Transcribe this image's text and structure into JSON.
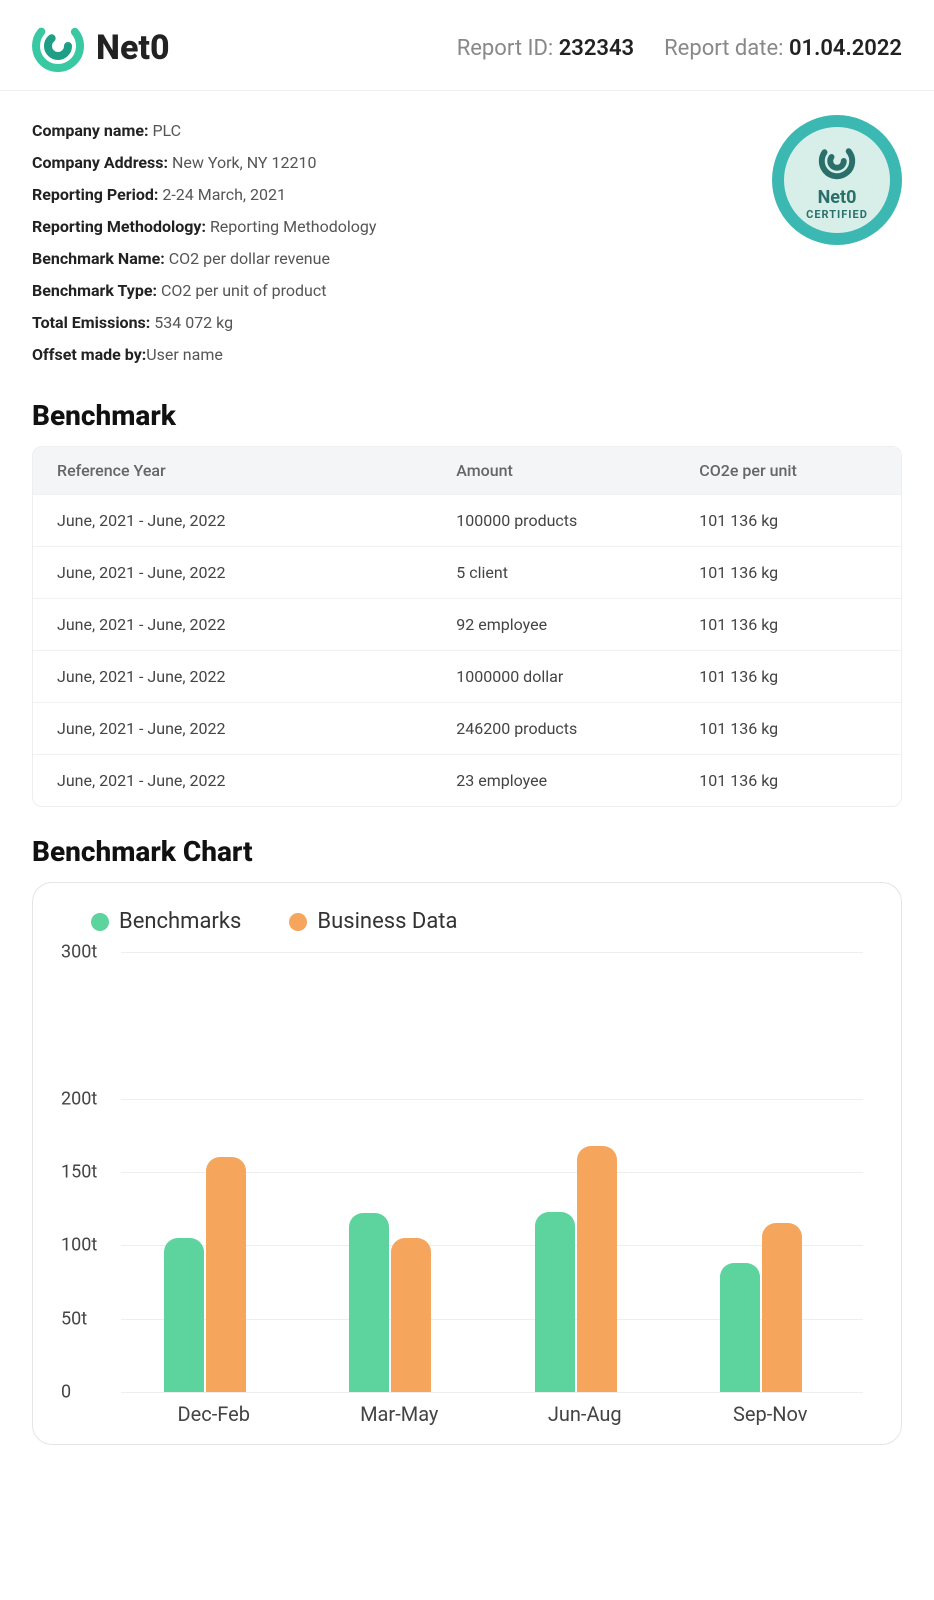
{
  "brand": {
    "name": "Net0"
  },
  "header": {
    "report_id_label": "Report ID:",
    "report_id": "232343",
    "report_date_label": "Report date:",
    "report_date": "01.04.2022"
  },
  "info": {
    "company_name_label": "Company name:",
    "company_name": "PLC",
    "address_label": "Company Address:",
    "address": "New York, NY 12210",
    "period_label": "Reporting Period:",
    "period": "2-24 March, 2021",
    "method_label": "Reporting Methodology:",
    "method": "Reporting Methodology",
    "bench_name_label": "Benchmark Name:",
    "bench_name": "CO2 per dollar revenue",
    "bench_type_label": "Benchmark Type:",
    "bench_type": "CO2 per unit of product",
    "total_label": "Total Emissions:",
    "total": "534 072 kg",
    "offset_label": "Offset made by:",
    "offset": "User name"
  },
  "badge": {
    "brand": "Net0",
    "text": "CERTIFIED"
  },
  "sections": {
    "benchmark_title": "Benchmark",
    "chart_title": "Benchmark Chart"
  },
  "table": {
    "headers": {
      "c1": "Reference Year",
      "c2": "Amount",
      "c3": "CO2e per unit"
    },
    "rows": [
      {
        "ref": "June, 2021 - June, 2022",
        "amount": "100000 products",
        "co2": "101 136 kg"
      },
      {
        "ref": "June, 2021 - June, 2022",
        "amount": "5 client",
        "co2": "101 136 kg"
      },
      {
        "ref": "June, 2021 - June, 2022",
        "amount": "92 employee",
        "co2": "101 136 kg"
      },
      {
        "ref": "June, 2021 - June, 2022",
        "amount": "1000000 dollar",
        "co2": "101 136 kg"
      },
      {
        "ref": "June, 2021 - June, 2022",
        "amount": "246200 products",
        "co2": "101 136 kg"
      },
      {
        "ref": "June, 2021 - June, 2022",
        "amount": "23 employee",
        "co2": "101 136 kg"
      }
    ]
  },
  "legend": {
    "a": "Benchmarks",
    "b": "Business Data"
  },
  "chart_data": {
    "type": "bar",
    "categories": [
      "Dec-Feb",
      "Mar-May",
      "Jun-Aug",
      "Sep-Nov"
    ],
    "series": [
      {
        "name": "Benchmarks",
        "values": [
          105,
          122,
          123,
          88
        ],
        "color": "#5dd39e"
      },
      {
        "name": "Business Data",
        "values": [
          160,
          105,
          168,
          115
        ],
        "color": "#f5a65c"
      }
    ],
    "ylabel": "t",
    "ylim": [
      0,
      300
    ],
    "yticks": [
      0,
      50,
      100,
      150,
      200,
      300
    ],
    "ytick_labels": [
      "0",
      "50t",
      "100t",
      "150t",
      "200t",
      "300t"
    ]
  }
}
